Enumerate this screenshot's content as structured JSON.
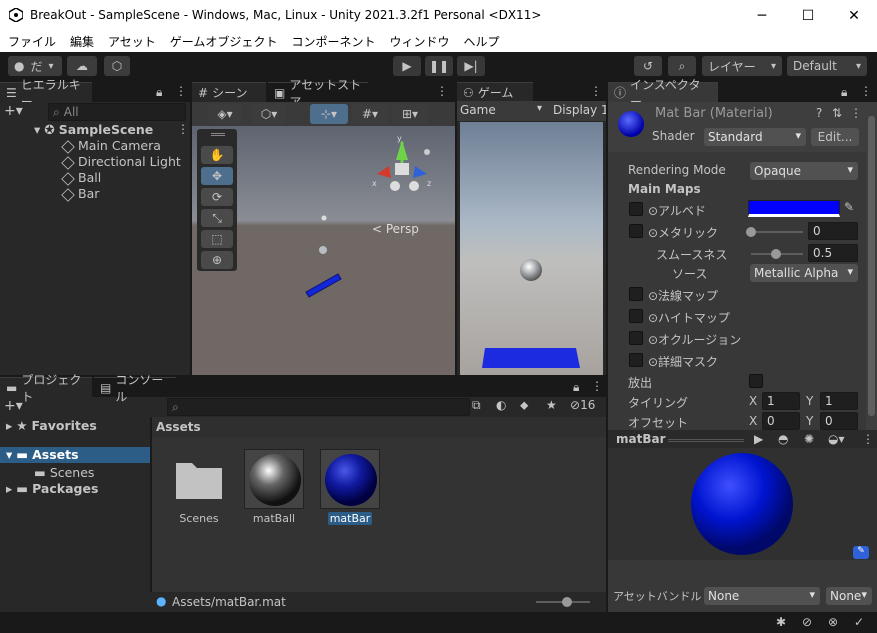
{
  "window": {
    "title": "BreakOut - SampleScene - Windows, Mac, Linux - Unity 2021.3.2f1 Personal <DX11>",
    "minimize": "─",
    "maximize": "☐",
    "close": "✕"
  },
  "menu": [
    "ファイル",
    "編集",
    "アセット",
    "ゲームオブジェクト",
    "コンポーネント",
    "ウィンドウ",
    "ヘルプ"
  ],
  "toolbar": {
    "account": "だ",
    "layers": "レイヤー",
    "layout": "Default"
  },
  "hierarchy": {
    "tab": "ヒエラルキー",
    "search_placeholder": "All",
    "scene": "SampleScene",
    "items": [
      "Main Camera",
      "Directional Light",
      "Ball",
      "Bar"
    ]
  },
  "scene": {
    "tab_scene": "シーン",
    "tab_asset_store": "アセットストア",
    "persp": "< Persp",
    "gizmo_y": "y",
    "gizmo_x": "x",
    "gizmo_z": "z"
  },
  "game": {
    "tab": "ゲーム",
    "view": "Game",
    "display": "Display 1"
  },
  "inspector": {
    "tab": "インスペクター",
    "title": "Mat Bar (Material)",
    "shader_label": "Shader",
    "shader_value": "Standard",
    "edit_button": "Edit...",
    "rendering_mode_label": "Rendering Mode",
    "rendering_mode_value": "Opaque",
    "main_maps": "Main Maps",
    "albedo": "⊙アルベド",
    "albedo_color": "#0000ff",
    "metallic": "⊙メタリック",
    "metallic_value": "0",
    "smoothness": "スムースネス",
    "smoothness_value": "0.5",
    "source": "ソース",
    "source_value": "Metallic Alpha",
    "normal": "⊙法線マップ",
    "height": "⊙ハイトマップ",
    "occlusion": "⊙オクルージョン",
    "detail": "⊙詳細マスク",
    "emission": "放出",
    "tiling": "タイリング",
    "tiling_x_label": "X",
    "tiling_x": "1",
    "tiling_y_label": "Y",
    "tiling_y": "1",
    "offset": "オフセット",
    "offset_x_label": "X",
    "offset_x": "0",
    "offset_y_label": "Y",
    "offset_y": "0",
    "preview_title": "matBar",
    "asset_bundle_label": "アセットバンドル",
    "asset_bundle_value": "None",
    "asset_bundle_variant": "None"
  },
  "project": {
    "tab_project": "プロジェクト",
    "tab_console": "コンソール",
    "hidden_count": "16",
    "favorites": "Favorites",
    "assets": "Assets",
    "scenes": "Scenes",
    "packages": "Packages",
    "assets_header": "Assets",
    "items": [
      {
        "label": "Scenes"
      },
      {
        "label": "matBall"
      },
      {
        "label": "matBar"
      }
    ],
    "path": "Assets/matBar.mat"
  },
  "colors": {
    "accent_blue": "#0000ff",
    "selection": "#2c5d87"
  }
}
